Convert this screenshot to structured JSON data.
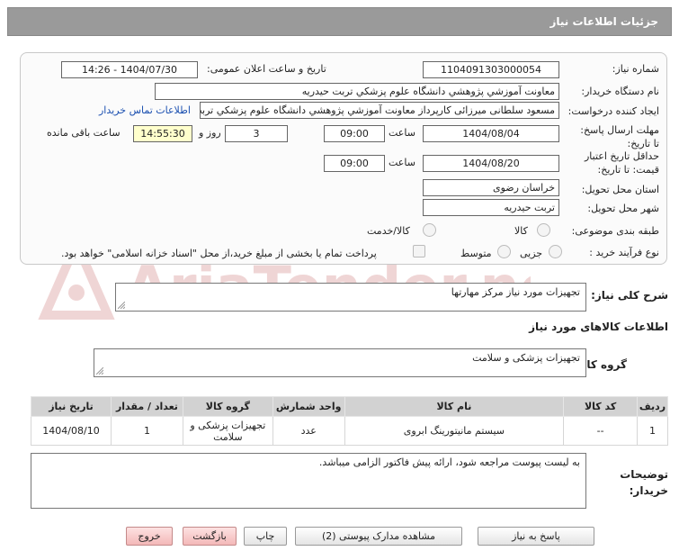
{
  "header": {
    "title": "جزئیات اطلاعات نیاز"
  },
  "form": {
    "need_number_label": "شماره نیاز:",
    "need_number": "1104091303000054",
    "announce_label": "تاریخ و ساعت اعلان عمومی:",
    "announce_value": "1404/07/30 - 14:26",
    "buyer_org_label": "نام دستگاه خریدار:",
    "buyer_org": "معاونت آموزشي پژوهشي   دانشگاه علوم پزشکي تربت حيدريه",
    "creator_label": "ایجاد کننده درخواست:",
    "creator": "مسعود سلطانی میرزائی کارپرداز معاونت آموزشي پژوهشي   دانشگاه علوم پزشکي تربت حيدريه",
    "contact_link": "اطلاعات تماس خریدار",
    "deadline_label": "مهلت ارسال پاسخ: تا تاریخ:",
    "deadline_date": "1404/08/04",
    "time_label": "ساعت",
    "deadline_time": "09:00",
    "days_value": "3",
    "days_label": "روز و",
    "remaining_time": "14:55:30",
    "remaining_label": "ساعت باقی مانده",
    "validity_label": "حداقل تاریخ اعتبار قیمت: تا تاریخ:",
    "validity_date": "1404/08/20",
    "validity_time": "09:00",
    "province_label": "استان محل تحویل:",
    "province": "خراسان رضوی",
    "city_label": "شهر محل تحویل:",
    "city": "تربت حیدریه",
    "category_label": "طبقه بندی موضوعی:",
    "category_options": [
      "کالا",
      "کالا/خدمت"
    ],
    "process_label": "نوع فرآیند خرید :",
    "process_options": [
      "جزیی",
      "متوسط"
    ],
    "payment_note": "پرداخت تمام یا بخشی از مبلغ خرید،از محل \"اسناد خزانه اسلامی\" خواهد بود."
  },
  "description": {
    "label": "شرح کلی نیاز:",
    "value": "تجهیزات مورد نیاز مرکز مهارتها"
  },
  "goods": {
    "section_title": "اطلاعات کالاهای مورد نیاز",
    "group_label": "گروه کالا:",
    "group_value": "تجهیزات پزشکی و سلامت"
  },
  "table": {
    "headers": [
      "ردیف",
      "کد کالا",
      "نام کالا",
      "واحد شمارش",
      "گروه کالا",
      "تعداد / مقدار",
      "تاریخ نیاز"
    ],
    "rows": [
      [
        "1",
        "--",
        "سیستم مانیتورینگ ابروی",
        "عدد",
        "تجهیزات پزشکی و سلامت",
        "1",
        "1404/08/10"
      ]
    ]
  },
  "buyer_notes": {
    "label": "توضیحات خریدار:",
    "value": "به لیست پیوست مراجعه شود، ارائه پیش فاکتور الزامی میباشد."
  },
  "buttons": {
    "reply": "پاسخ به نیاز",
    "attachments": "مشاهده مدارک پیوستی (2)",
    "print": "چاپ",
    "back": "بازگشت",
    "exit": "خروج"
  },
  "watermark_text": "AriaTender.neT",
  "colors": {
    "header_bg": "#9a9a9a",
    "link": "#1a4fb0",
    "remaining_bg": "#ffffcc",
    "watermark": "#d9a0a0"
  }
}
